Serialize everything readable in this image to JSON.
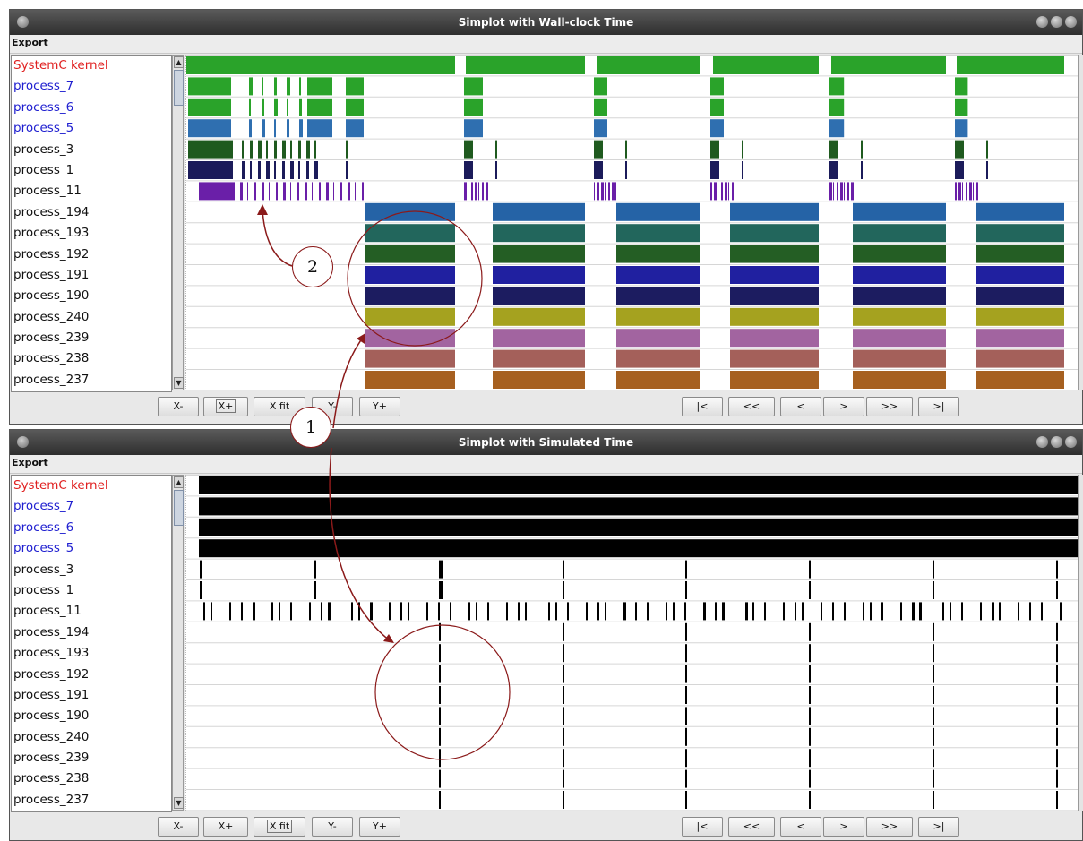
{
  "windows": [
    {
      "title": "Simplot with Wall-clock Time",
      "menu": "Export",
      "pressed": "X+",
      "row_colors": [
        "#2aa32a",
        "#2aa32a",
        "#2aa32a",
        "#2f6fb0",
        "#1f5a1f",
        "#1b1b5a",
        "#6a1fa8",
        "#2563a6",
        "#22665c",
        "#245e24",
        "#2020a0",
        "#1c1c60",
        "#a5a21f",
        "#a264a0",
        "#a4605a",
        "#a66020"
      ]
    },
    {
      "title": "Simplot with Simulated Time",
      "menu": "Export",
      "pressed": "X fit",
      "row_colors": [
        "#000000",
        "#000000",
        "#000000",
        "#000000",
        "#000000",
        "#000000",
        "#000000",
        "#000000",
        "#000000",
        "#000000",
        "#000000",
        "#000000",
        "#000000",
        "#000000",
        "#000000",
        "#000000"
      ]
    }
  ],
  "processes": [
    {
      "name": "SystemC kernel",
      "color": "#e02020"
    },
    {
      "name": "process_7",
      "color": "#2020d0"
    },
    {
      "name": "process_6",
      "color": "#2020d0"
    },
    {
      "name": "process_5",
      "color": "#2020d0"
    },
    {
      "name": "process_3",
      "color": "#111111"
    },
    {
      "name": "process_1",
      "color": "#111111"
    },
    {
      "name": "process_11",
      "color": "#111111"
    },
    {
      "name": "process_194",
      "color": "#111111"
    },
    {
      "name": "process_193",
      "color": "#111111"
    },
    {
      "name": "process_192",
      "color": "#111111"
    },
    {
      "name": "process_191",
      "color": "#111111"
    },
    {
      "name": "process_190",
      "color": "#111111"
    },
    {
      "name": "process_240",
      "color": "#111111"
    },
    {
      "name": "process_239",
      "color": "#111111"
    },
    {
      "name": "process_238",
      "color": "#111111"
    },
    {
      "name": "process_237",
      "color": "#111111"
    }
  ],
  "buttons": {
    "zoom": [
      "X-",
      "X+",
      "X fit",
      "Y-",
      "Y+"
    ],
    "nav": [
      "|<",
      "<<",
      "<",
      ">",
      ">>",
      ">|"
    ]
  },
  "scroll_icons": {
    "up": "up-arrow-icon",
    "down": "down-arrow-icon"
  },
  "annotations": {
    "marker_1": "1",
    "marker_2": "2",
    "stroke_color": "#8b1a1a"
  }
}
